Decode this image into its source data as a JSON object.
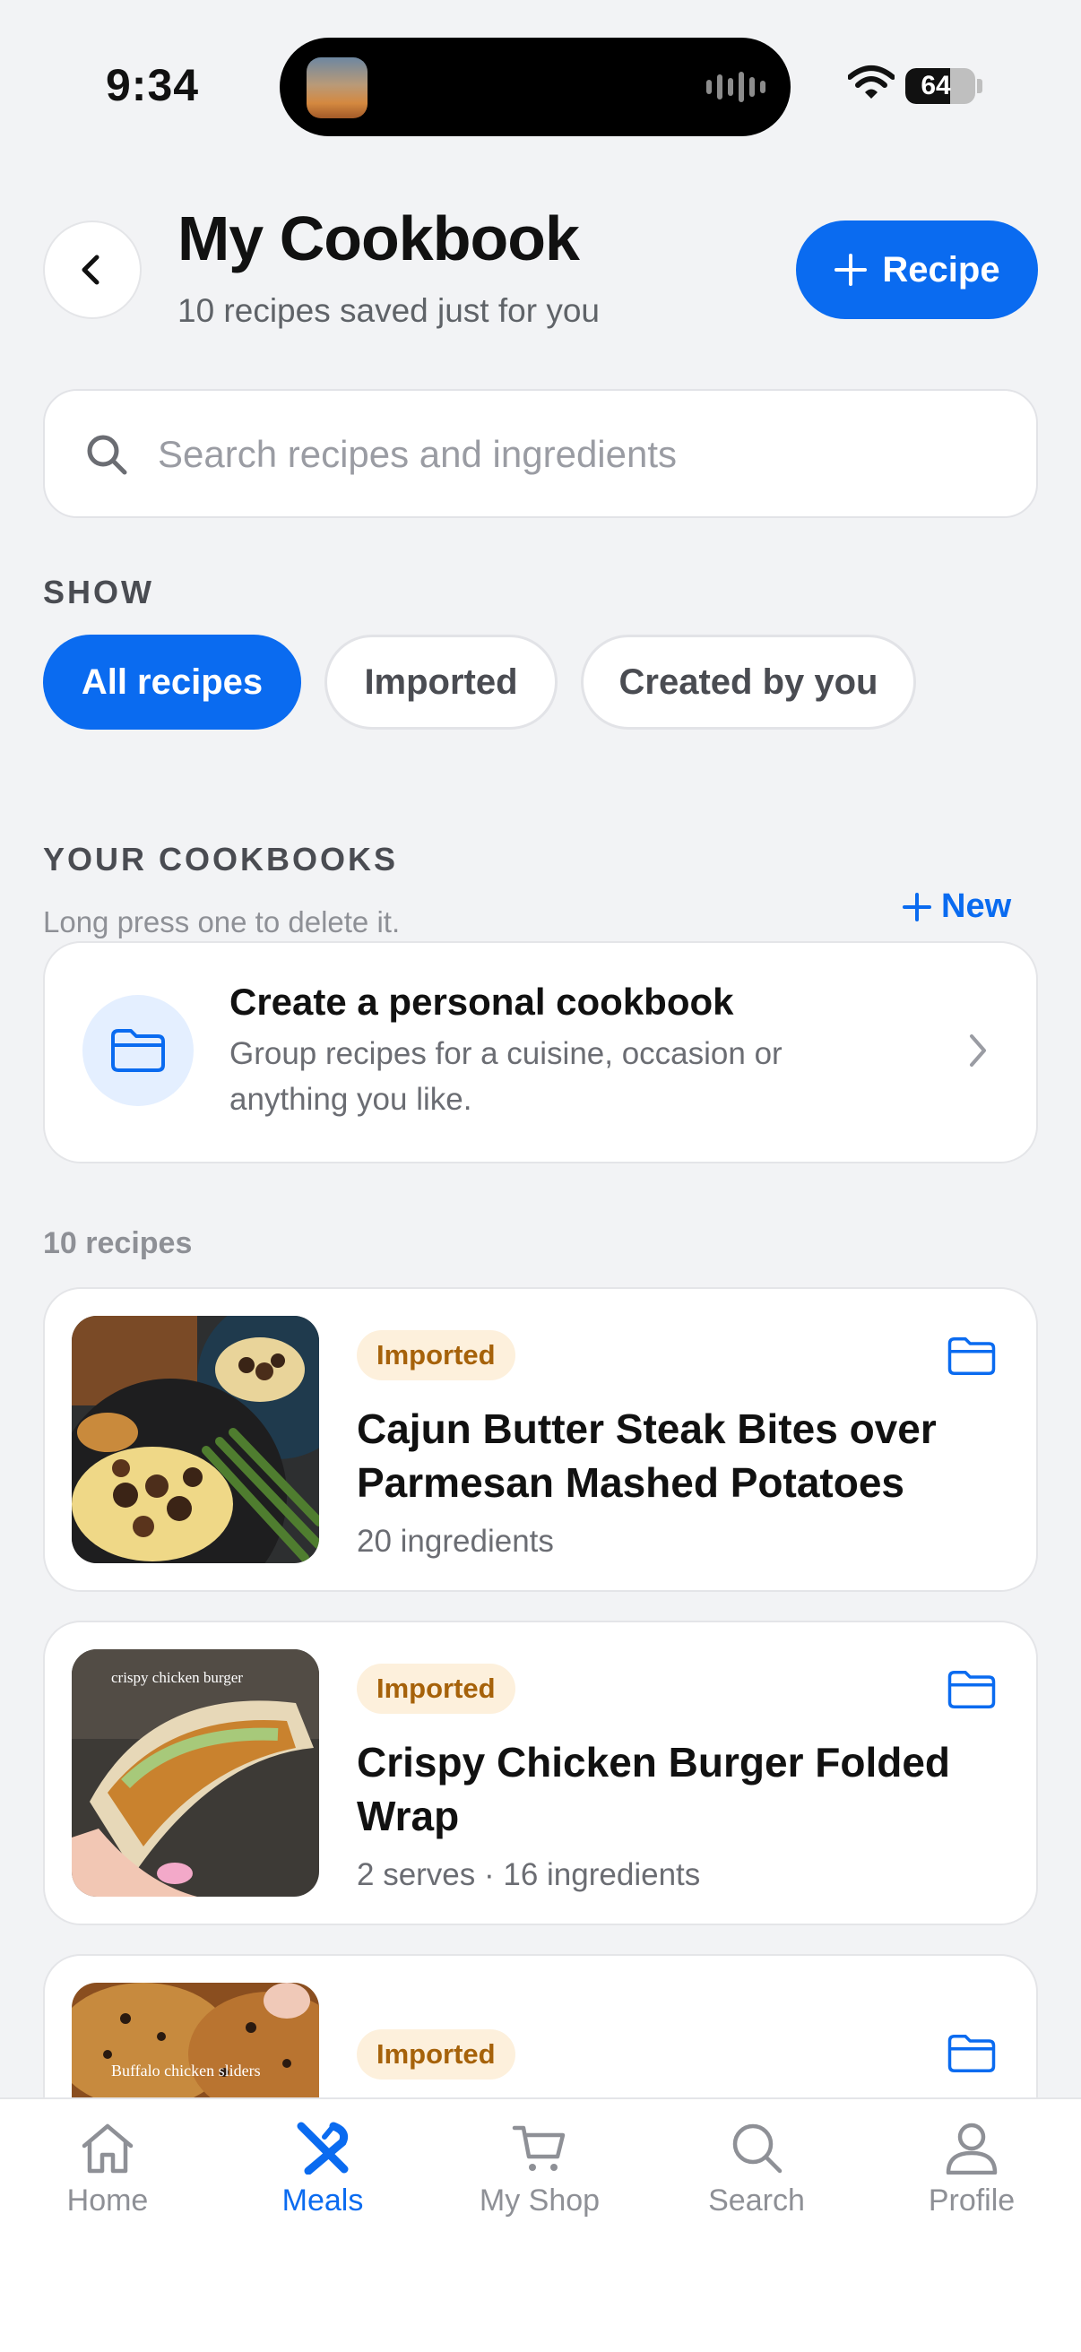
{
  "status_bar": {
    "time": "9:34",
    "battery": "64",
    "battery_level": 0.64
  },
  "header": {
    "title": "My Cookbook",
    "subtitle": "10 recipes saved just for you",
    "add_button_label": "Recipe"
  },
  "search": {
    "placeholder": "Search recipes and ingredients",
    "value": ""
  },
  "filters": {
    "label": "SHOW",
    "chips": [
      {
        "label": "All recipes",
        "active": true
      },
      {
        "label": "Imported",
        "active": false
      },
      {
        "label": "Created by you",
        "active": false
      }
    ]
  },
  "cookbooks": {
    "label": "YOUR COOKBOOKS",
    "hint": "Long press one to delete it.",
    "new_label": "New",
    "create_card": {
      "title": "Create a personal cookbook",
      "description": "Group recipes for a cuisine, occasion or anything you like."
    }
  },
  "recipes": {
    "count_label": "10 recipes",
    "items": [
      {
        "badge": "Imported",
        "title": "Cajun Butter Steak Bites over Parmesan Mashed Potatoes",
        "meta": "20 ingredients",
        "thumb_caption": ""
      },
      {
        "badge": "Imported",
        "title": "Crispy Chicken Burger Folded Wrap",
        "meta": "2 serves · 16 ingredients",
        "thumb_caption": "crispy chicken burger"
      },
      {
        "badge": "Imported",
        "title": "",
        "meta": "",
        "thumb_caption": "Buffalo chicken sliders"
      }
    ]
  },
  "tabbar": {
    "tabs": [
      {
        "label": "Home",
        "icon": "home-icon",
        "active": false
      },
      {
        "label": "Meals",
        "icon": "utensils-icon",
        "active": true
      },
      {
        "label": "My Shop",
        "icon": "cart-icon",
        "active": false
      },
      {
        "label": "Search",
        "icon": "search-icon",
        "active": false
      },
      {
        "label": "Profile",
        "icon": "person-icon",
        "active": false
      }
    ]
  },
  "colors": {
    "accent": "#0a6bf0",
    "badge_bg": "#fdf0dc",
    "badge_text": "#a6620a",
    "background": "#f2f3f5"
  }
}
